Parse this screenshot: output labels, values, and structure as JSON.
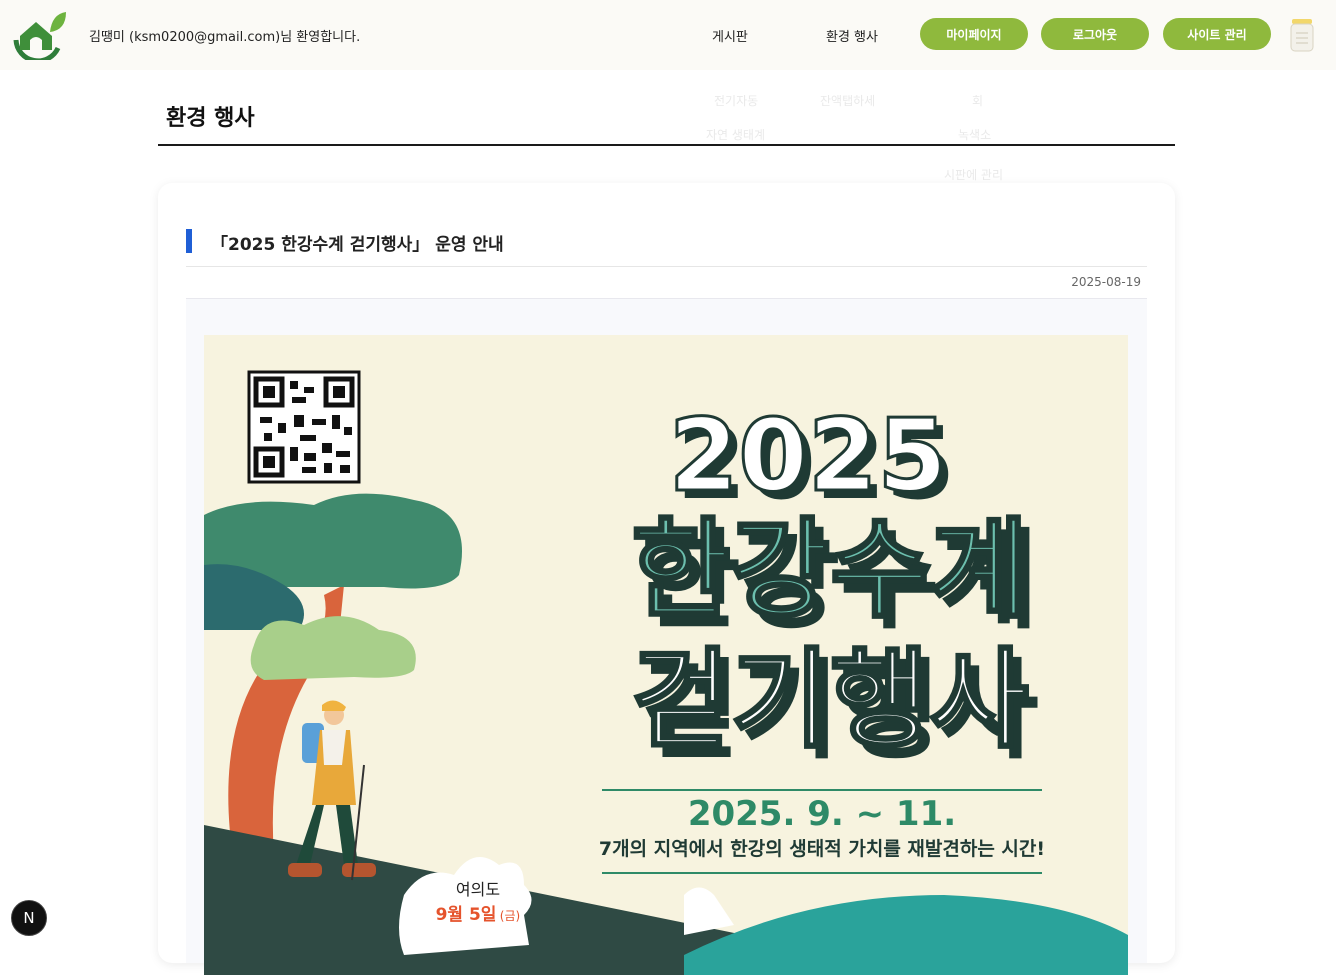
{
  "header": {
    "welcome": "김땡미 (ksm0200@gmail.com)님 환영합니다.",
    "nav": {
      "board": "게시판",
      "events": "환경 행사"
    },
    "buttons": {
      "mypage": "마이페이지",
      "logout": "로그아웃",
      "admin": "사이트 관리"
    }
  },
  "dropdown_ghost": {
    "items": [
      "전기자동",
      "잔액탭하세",
      "회",
      "자연 생태계",
      "녹색소",
      "시판에 관리"
    ]
  },
  "page": {
    "title": "환경 행사"
  },
  "post": {
    "title": "「2025 한강수계 걷기행사」 운영 안내",
    "date": "2025-08-19"
  },
  "poster": {
    "year": "2025",
    "headline_top": "한강수계",
    "headline_bottom": "걷기행사",
    "dates": "2025. 9. ~ 11.",
    "tagline": "7개의 지역에서 한강의 생태적 가치를 재발견하는 시간!",
    "location_name": "여의도",
    "location_date": "9월 5일",
    "location_day": "(금)"
  },
  "dev_badge": {
    "letter": "N"
  },
  "colors": {
    "accent_green": "#8fb93d",
    "title_bar_blue": "#1f5fd6",
    "poster_bg": "#f7f3df"
  }
}
